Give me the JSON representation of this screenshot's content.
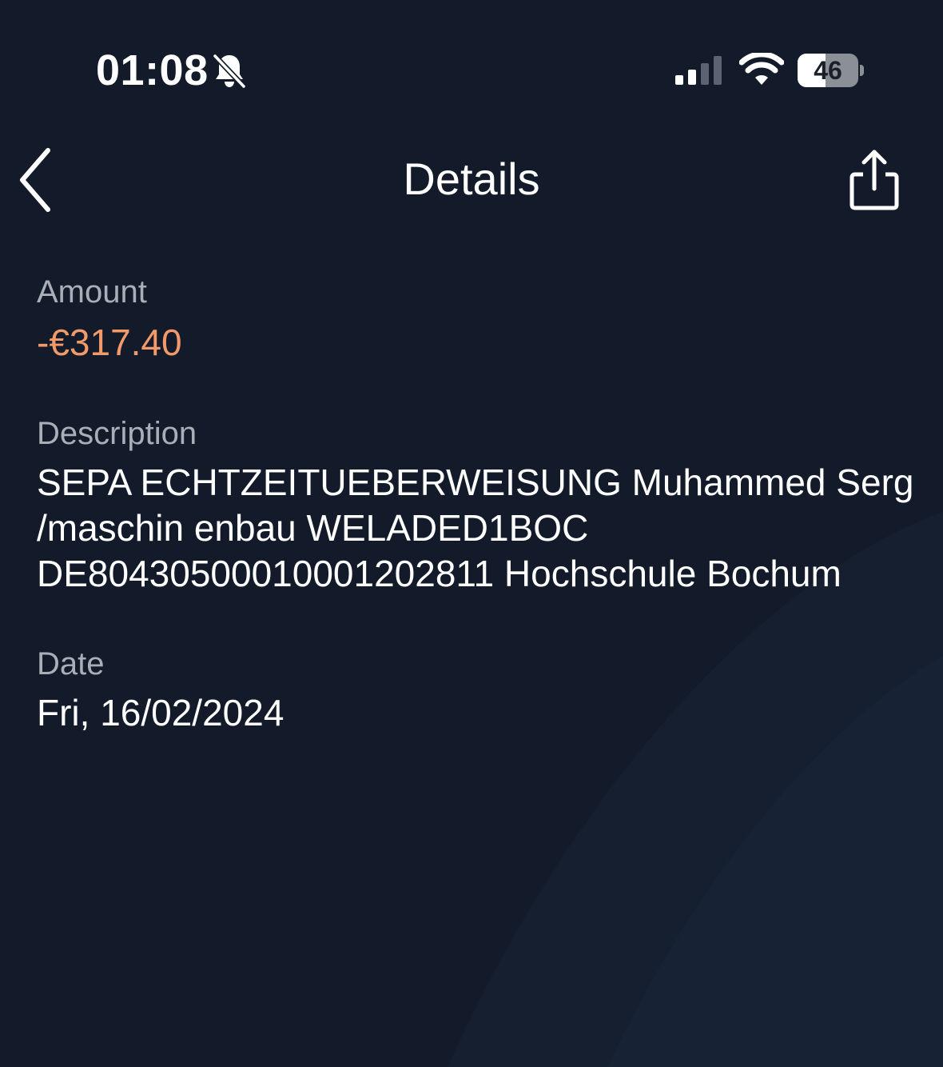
{
  "status_bar": {
    "time": "01:08",
    "battery": "46",
    "battery_level": 0.46,
    "icons": [
      "bell-slash-icon",
      "cellular-signal-icon",
      "wifi-icon",
      "battery-icon"
    ]
  },
  "nav": {
    "title": "Details",
    "back_icon": "chevron-left-icon",
    "share_icon": "share-icon"
  },
  "details": {
    "amount_label": "Amount",
    "amount_value": "-€317.40",
    "description_label": "Description",
    "description_value": "SEPA ECHTZEITUEBERWEISUNG Muhammed Serg /maschin enbau WELADED1BOC DE80430500010001202811 Hochschule Bochum",
    "date_label": "Date",
    "date_value": "Fri, 16/02/2024"
  },
  "colors": {
    "background": "#131b2b",
    "amount_negative": "#f39a6a",
    "label": "#a9aeb7",
    "text": "#ffffff"
  }
}
